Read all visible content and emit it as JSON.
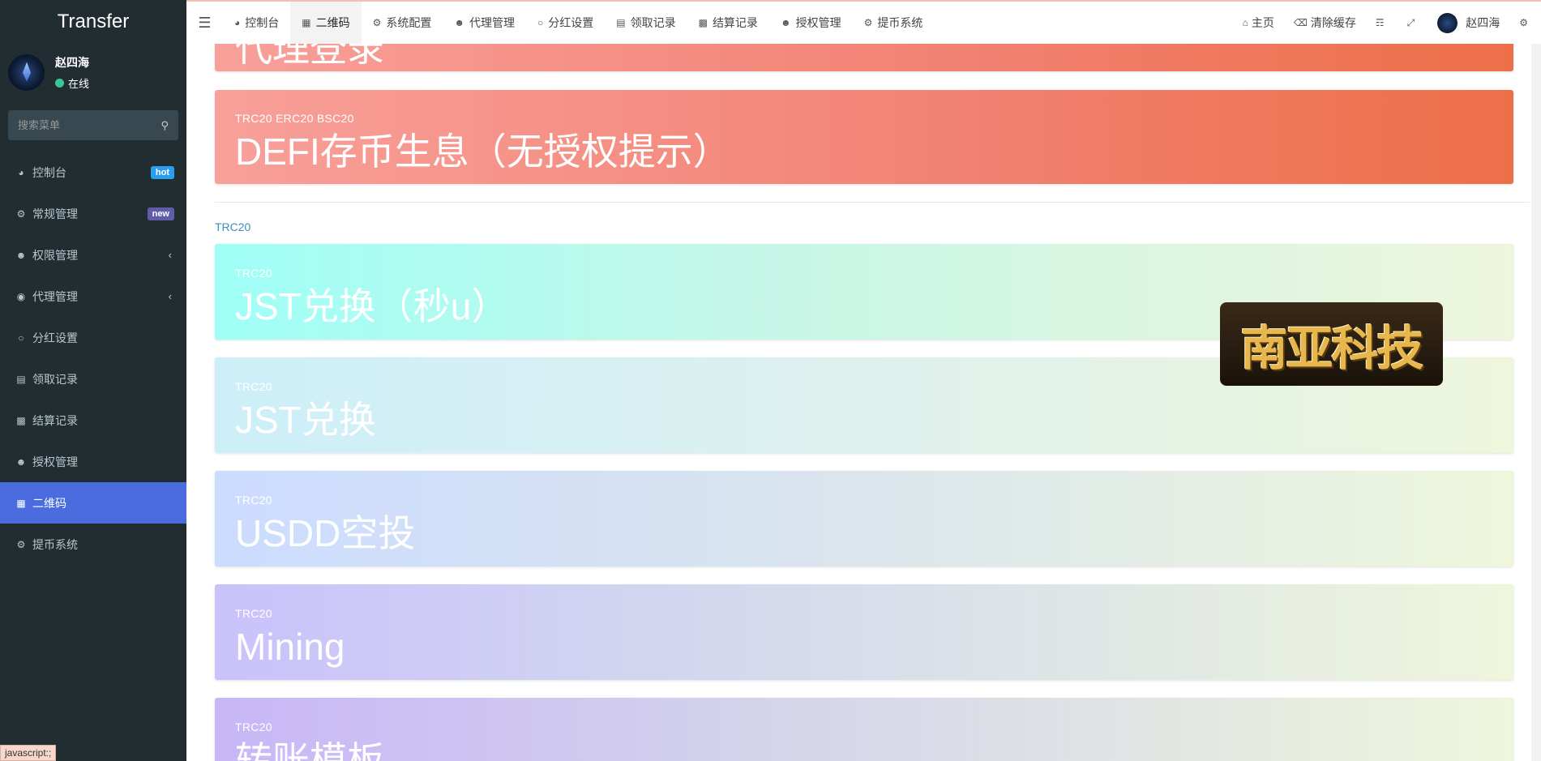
{
  "app": {
    "title": "Transfer"
  },
  "user": {
    "name": "赵四海",
    "status": "在线"
  },
  "search": {
    "placeholder": "搜索菜单"
  },
  "sidebar": {
    "items": [
      {
        "label": "控制台",
        "icon": "dashboard-icon",
        "badge": "hot"
      },
      {
        "label": "常规管理",
        "icon": "cogs-icon",
        "badge": "new"
      },
      {
        "label": "权限管理",
        "icon": "users-icon",
        "chevron": "‹"
      },
      {
        "label": "代理管理",
        "icon": "user-circle-icon",
        "chevron": "‹"
      },
      {
        "label": "分红设置",
        "icon": "circle-icon"
      },
      {
        "label": "领取记录",
        "icon": "bars-icon"
      },
      {
        "label": "结算记录",
        "icon": "money-icon"
      },
      {
        "label": "授权管理",
        "icon": "users-icon"
      },
      {
        "label": "二维码",
        "icon": "qrcode-icon",
        "active": true
      },
      {
        "label": "提币系统",
        "icon": "gear-icon"
      }
    ]
  },
  "topbar": {
    "tabs": [
      {
        "label": "控制台",
        "icon": "dashboard-icon"
      },
      {
        "label": "二维码",
        "icon": "qrcode-icon",
        "active": true
      },
      {
        "label": "系统配置",
        "icon": "gear-icon"
      },
      {
        "label": "代理管理",
        "icon": "user-icon"
      },
      {
        "label": "分红设置",
        "icon": "circle-icon"
      },
      {
        "label": "领取记录",
        "icon": "bars-icon"
      },
      {
        "label": "结算记录",
        "icon": "money-icon"
      },
      {
        "label": "授权管理",
        "icon": "users-icon"
      },
      {
        "label": "提币系统",
        "icon": "gear-icon"
      }
    ],
    "right": {
      "home": "主页",
      "clear_cache": "清除缓存",
      "username": "赵四海"
    }
  },
  "content": {
    "cards_top": [
      {
        "sub": "",
        "main": "代理登录"
      },
      {
        "sub": "TRC20 ERC20 BSC20",
        "main": "DEFI存币生息（无授权提示）"
      }
    ],
    "section": "TRC20",
    "cards": [
      {
        "sub": "TRC20",
        "main": "JST兑换（秒u）"
      },
      {
        "sub": "TRC20",
        "main": "JST兑换"
      },
      {
        "sub": "TRC20",
        "main": "USDD空投"
      },
      {
        "sub": "TRC20",
        "main": "Mining"
      },
      {
        "sub": "TRC20",
        "main": "转账模板"
      }
    ],
    "watermark": "南亚科技"
  },
  "statusbar": {
    "text": "javascript:;"
  }
}
